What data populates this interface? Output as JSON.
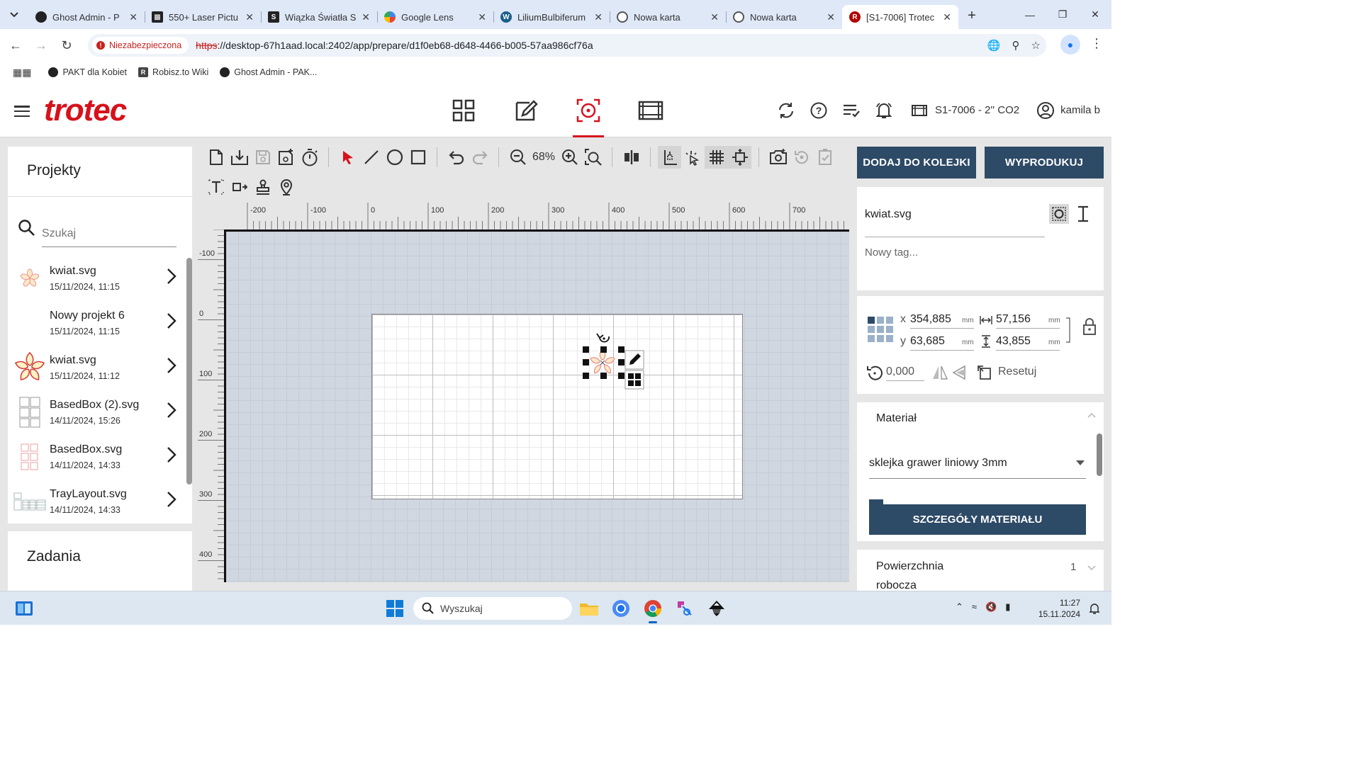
{
  "browser": {
    "tabs": [
      {
        "label": "Ghost Admin - P",
        "fav": "circle"
      },
      {
        "label": "550+ Laser Pictu",
        "fav": "sq"
      },
      {
        "label": "Wiązka Światła S",
        "fav": "sq-s"
      },
      {
        "label": "Google Lens",
        "fav": "lens"
      },
      {
        "label": "LiliumBulbiferum",
        "fav": "wiki"
      },
      {
        "label": "Nowa karta",
        "fav": "globe"
      },
      {
        "label": "Nowa karta",
        "fav": "globe"
      },
      {
        "label": "[S1-7006] Trotec",
        "fav": "red",
        "active": true
      }
    ],
    "insecure_label": "Niezabezpieczona",
    "url_scheme": "https",
    "url_rest": "://desktop-67h1aad.local:2402/app/prepare/d1f0eb68-d648-4466-b005-57aa986cf76a",
    "bookmarks": [
      "PAKT dla Kobiet",
      "Robisz.to Wiki",
      "Ghost Admin - PAK..."
    ]
  },
  "app": {
    "logo": "trotec",
    "machine": "S1-7006 - 2'' CO2",
    "user": "kamila b"
  },
  "projects": {
    "title": "Projekty",
    "search_placeholder": "Szukaj",
    "items": [
      {
        "name": "kwiat.svg",
        "date": "15/11/2024, 11:15",
        "thumb": "flower-small"
      },
      {
        "name": "Nowy projekt 6",
        "date": "15/11/2024, 11:15",
        "thumb": "none"
      },
      {
        "name": "kwiat.svg",
        "date": "15/11/2024, 11:12",
        "thumb": "flower"
      },
      {
        "name": "BasedBox (2).svg",
        "date": "14/11/2024, 15:26",
        "thumb": "box"
      },
      {
        "name": "BasedBox.svg",
        "date": "14/11/2024, 14:33",
        "thumb": "box-red"
      },
      {
        "name": "TrayLayout.svg",
        "date": "14/11/2024, 14:33",
        "thumb": "tray"
      }
    ]
  },
  "tasks": {
    "title": "Zadania"
  },
  "toolbar": {
    "zoom": "68%"
  },
  "rulers": {
    "h_labels": [
      "-200",
      "-100",
      "0",
      "100",
      "200",
      "300",
      "400",
      "500",
      "600",
      "700"
    ],
    "v_labels": [
      "-100",
      "0",
      "100",
      "200",
      "300",
      "400"
    ]
  },
  "right": {
    "queue_button": "DODAJ DO KOLEJKI",
    "produce_button": "WYPRODUKUJ",
    "file_name": "kwiat.svg",
    "tag_placeholder": "Nowy tag...",
    "x_label": "x",
    "y_label": "y",
    "x_value": "354,885",
    "y_value": "63,685",
    "width_value": "57,156",
    "height_value": "43,855",
    "unit": "mm",
    "rotation": "0,000",
    "reset_label": "Resetuj",
    "material_title": "Materiał",
    "material_value": "sklejka grawer liniowy 3mm",
    "material_details_button": "SZCZEGÓŁY MATERIAŁU",
    "workarea_label_1": "Powierzchnia",
    "workarea_label_2": "robocza",
    "workarea_value": "1"
  },
  "taskbar": {
    "search_placeholder": "Wyszukaj",
    "time": "11:27",
    "date": "15.11.2024"
  },
  "colors": {
    "brand": "#d7111b",
    "button": "#2d4a66",
    "canvas": "#d0d7e1"
  }
}
